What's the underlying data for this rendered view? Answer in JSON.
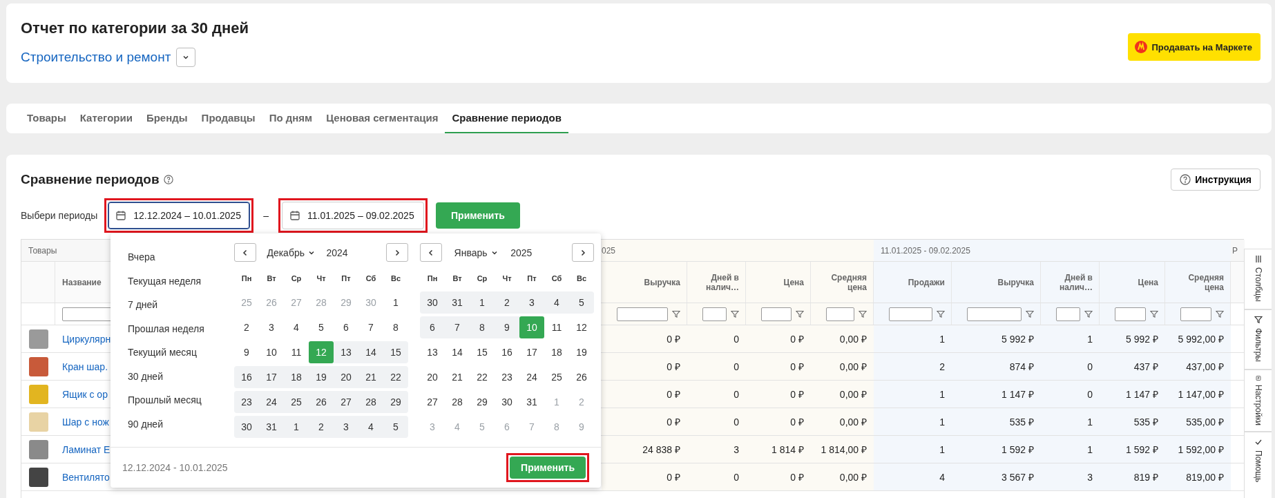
{
  "header": {
    "title": "Отчет по категории за 30 дней",
    "category": "Строительство и ремонт",
    "market_button": "Продавать на Маркете"
  },
  "tabs": [
    {
      "label": "Товары",
      "selected": false
    },
    {
      "label": "Категории",
      "selected": false
    },
    {
      "label": "Бренды",
      "selected": false
    },
    {
      "label": "Продавцы",
      "selected": false
    },
    {
      "label": "По дням",
      "selected": false
    },
    {
      "label": "Ценовая сегментация",
      "selected": false
    },
    {
      "label": "Сравнение периодов",
      "selected": true
    }
  ],
  "section": {
    "title": "Сравнение периодов",
    "instructions_button": "Инструкция",
    "period_label": "Выбери периоды",
    "separator": "–",
    "apply_button": "Применить",
    "periods": [
      {
        "value": "12.12.2024 – 10.01.2025",
        "active": true,
        "highlighted": true
      },
      {
        "value": "11.01.2025 – 09.02.2025",
        "active": false,
        "highlighted": true
      }
    ]
  },
  "table": {
    "products_group": "Товары",
    "name_column": "Название",
    "cut_group": "Р",
    "periods": [
      {
        "label": "025",
        "kind": "base",
        "columns": [
          "Выручка",
          "Дней в налич…",
          "Цена",
          "Средняя цена"
        ]
      },
      {
        "label": "11.01.2025 - 09.02.2025",
        "kind": "compare",
        "columns": [
          "Продажи",
          "Выручка",
          "Дней в налич…",
          "Цена",
          "Средняя цена"
        ]
      }
    ],
    "rows": [
      {
        "name": "Циркулярн",
        "values": [
          [
            "0 ₽",
            "0",
            "0 ₽",
            "0,00 ₽"
          ],
          [
            "1",
            "5 992 ₽",
            "1",
            "5 992 ₽",
            "5 992,00 ₽"
          ]
        ]
      },
      {
        "name": "Кран шар.",
        "values": [
          [
            "0 ₽",
            "0",
            "0 ₽",
            "0,00 ₽"
          ],
          [
            "2",
            "874 ₽",
            "0",
            "437 ₽",
            "437,00 ₽"
          ]
        ]
      },
      {
        "name": "Ящик с ор",
        "values": [
          [
            "0 ₽",
            "0",
            "0 ₽",
            "0,00 ₽"
          ],
          [
            "1",
            "1 147 ₽",
            "0",
            "1 147 ₽",
            "1 147,00 ₽"
          ]
        ]
      },
      {
        "name": "Шар с нож",
        "values": [
          [
            "0 ₽",
            "0",
            "0 ₽",
            "0,00 ₽"
          ],
          [
            "1",
            "535 ₽",
            "1",
            "535 ₽",
            "535,00 ₽"
          ]
        ]
      },
      {
        "name": "Ламинат E",
        "values": [
          [
            "24 838 ₽",
            "3",
            "1 814 ₽",
            "1 814,00 ₽"
          ],
          [
            "1",
            "1 592 ₽",
            "1",
            "1 592 ₽",
            "1 592,00 ₽"
          ]
        ]
      },
      {
        "name": "Вентилято",
        "values": [
          [
            "0 ₽",
            "0",
            "0 ₽",
            "0,00 ₽"
          ],
          [
            "4",
            "3 567 ₽",
            "3",
            "819 ₽",
            "819,00 ₽"
          ]
        ]
      }
    ]
  },
  "side_tabs": [
    {
      "label": "Столбцы",
      "kind": "columns"
    },
    {
      "label": "Фильтры",
      "kind": "filters"
    },
    {
      "label": "Настройки",
      "kind": "settings"
    },
    {
      "label": "Помощь",
      "kind": "help"
    }
  ],
  "date_picker": {
    "presets": [
      "Вчера",
      "Текущая неделя",
      "7 дней",
      "Прошлая неделя",
      "Текущий месяц",
      "30 дней",
      "Прошлый месяц",
      "90 дней"
    ],
    "calendars": [
      {
        "month": "Декабрь",
        "year": "2024",
        "weekdays": [
          "Пн",
          "Вт",
          "Ср",
          "Чт",
          "Пт",
          "Сб",
          "Вс"
        ],
        "weeks": [
          [
            {
              "day": "25",
              "kind": "outside",
              "selected": false
            },
            {
              "day": "26",
              "kind": "outside",
              "selected": false
            },
            {
              "day": "27",
              "kind": "outside",
              "selected": false
            },
            {
              "day": "28",
              "kind": "outside",
              "selected": false
            },
            {
              "day": "29",
              "kind": "outside",
              "selected": false
            },
            {
              "day": "30",
              "kind": "outside",
              "selected": false
            },
            {
              "day": "1",
              "kind": "plain",
              "selected": false
            }
          ],
          [
            {
              "day": "2",
              "kind": "plain",
              "selected": false
            },
            {
              "day": "3",
              "kind": "plain",
              "selected": false
            },
            {
              "day": "4",
              "kind": "plain",
              "selected": false
            },
            {
              "day": "5",
              "kind": "plain",
              "selected": false
            },
            {
              "day": "6",
              "kind": "plain",
              "selected": false
            },
            {
              "day": "7",
              "kind": "plain",
              "selected": false
            },
            {
              "day": "8",
              "kind": "plain",
              "selected": false
            }
          ],
          [
            {
              "day": "9",
              "kind": "plain",
              "selected": false
            },
            {
              "day": "10",
              "kind": "plain",
              "selected": false
            },
            {
              "day": "11",
              "kind": "plain",
              "selected": false
            },
            {
              "day": "12",
              "kind": "range",
              "selected": true
            },
            {
              "day": "13",
              "kind": "range",
              "selected": false
            },
            {
              "day": "14",
              "kind": "range",
              "selected": false
            },
            {
              "day": "15",
              "kind": "range",
              "selected": false
            }
          ],
          [
            {
              "day": "16",
              "kind": "range",
              "selected": false
            },
            {
              "day": "17",
              "kind": "range",
              "selected": false
            },
            {
              "day": "18",
              "kind": "range",
              "selected": false
            },
            {
              "day": "19",
              "kind": "range",
              "selected": false
            },
            {
              "day": "20",
              "kind": "range",
              "selected": false
            },
            {
              "day": "21",
              "kind": "range",
              "selected": false
            },
            {
              "day": "22",
              "kind": "range",
              "selected": false
            }
          ],
          [
            {
              "day": "23",
              "kind": "range",
              "selected": false
            },
            {
              "day": "24",
              "kind": "range",
              "selected": false
            },
            {
              "day": "25",
              "kind": "range",
              "selected": false
            },
            {
              "day": "26",
              "kind": "range",
              "selected": false
            },
            {
              "day": "27",
              "kind": "range",
              "selected": false
            },
            {
              "day": "28",
              "kind": "range",
              "selected": false
            },
            {
              "day": "29",
              "kind": "range",
              "selected": false
            }
          ],
          [
            {
              "day": "30",
              "kind": "range",
              "selected": false
            },
            {
              "day": "31",
              "kind": "range",
              "selected": false
            },
            {
              "day": "1",
              "kind": "range",
              "selected": false
            },
            {
              "day": "2",
              "kind": "range",
              "selected": false
            },
            {
              "day": "3",
              "kind": "range",
              "selected": false
            },
            {
              "day": "4",
              "kind": "range",
              "selected": false
            },
            {
              "day": "5",
              "kind": "range",
              "selected": false
            }
          ]
        ]
      },
      {
        "month": "Январь",
        "year": "2025",
        "weekdays": [
          "Пн",
          "Вт",
          "Ср",
          "Чт",
          "Пт",
          "Сб",
          "Вс"
        ],
        "weeks": [
          [
            {
              "day": "30",
              "kind": "range",
              "selected": false
            },
            {
              "day": "31",
              "kind": "range",
              "selected": false
            },
            {
              "day": "1",
              "kind": "range",
              "selected": false
            },
            {
              "day": "2",
              "kind": "range",
              "selected": false
            },
            {
              "day": "3",
              "kind": "range",
              "selected": false
            },
            {
              "day": "4",
              "kind": "range",
              "selected": false
            },
            {
              "day": "5",
              "kind": "range",
              "selected": false
            }
          ],
          [
            {
              "day": "6",
              "kind": "range",
              "selected": false
            },
            {
              "day": "7",
              "kind": "range",
              "selected": false
            },
            {
              "day": "8",
              "kind": "range",
              "selected": false
            },
            {
              "day": "9",
              "kind": "range",
              "selected": false
            },
            {
              "day": "10",
              "kind": "range",
              "selected": true
            },
            {
              "day": "11",
              "kind": "plain",
              "selected": false
            },
            {
              "day": "12",
              "kind": "plain",
              "selected": false
            }
          ],
          [
            {
              "day": "13",
              "kind": "plain",
              "selected": false
            },
            {
              "day": "14",
              "kind": "plain",
              "selected": false
            },
            {
              "day": "15",
              "kind": "plain",
              "selected": false
            },
            {
              "day": "16",
              "kind": "plain",
              "selected": false
            },
            {
              "day": "17",
              "kind": "plain",
              "selected": false
            },
            {
              "day": "18",
              "kind": "plain",
              "selected": false
            },
            {
              "day": "19",
              "kind": "plain",
              "selected": false
            }
          ],
          [
            {
              "day": "20",
              "kind": "plain",
              "selected": false
            },
            {
              "day": "21",
              "kind": "plain",
              "selected": false
            },
            {
              "day": "22",
              "kind": "plain",
              "selected": false
            },
            {
              "day": "23",
              "kind": "plain",
              "selected": false
            },
            {
              "day": "24",
              "kind": "plain",
              "selected": false
            },
            {
              "day": "25",
              "kind": "plain",
              "selected": false
            },
            {
              "day": "26",
              "kind": "plain",
              "selected": false
            }
          ],
          [
            {
              "day": "27",
              "kind": "plain",
              "selected": false
            },
            {
              "day": "28",
              "kind": "plain",
              "selected": false
            },
            {
              "day": "29",
              "kind": "plain",
              "selected": false
            },
            {
              "day": "30",
              "kind": "plain",
              "selected": false
            },
            {
              "day": "31",
              "kind": "plain",
              "selected": false
            },
            {
              "day": "1",
              "kind": "outside",
              "selected": false
            },
            {
              "day": "2",
              "kind": "outside",
              "selected": false
            }
          ],
          [
            {
              "day": "3",
              "kind": "outside",
              "selected": false
            },
            {
              "day": "4",
              "kind": "outside",
              "selected": false
            },
            {
              "day": "5",
              "kind": "outside",
              "selected": false
            },
            {
              "day": "6",
              "kind": "outside",
              "selected": false
            },
            {
              "day": "7",
              "kind": "outside",
              "selected": false
            },
            {
              "day": "8",
              "kind": "outside",
              "selected": false
            },
            {
              "day": "9",
              "kind": "outside",
              "selected": false
            }
          ]
        ]
      }
    ],
    "footer_range": "12.12.2024 - 10.01.2025",
    "apply_button": {
      "label": "Применить",
      "highlighted": true
    }
  }
}
